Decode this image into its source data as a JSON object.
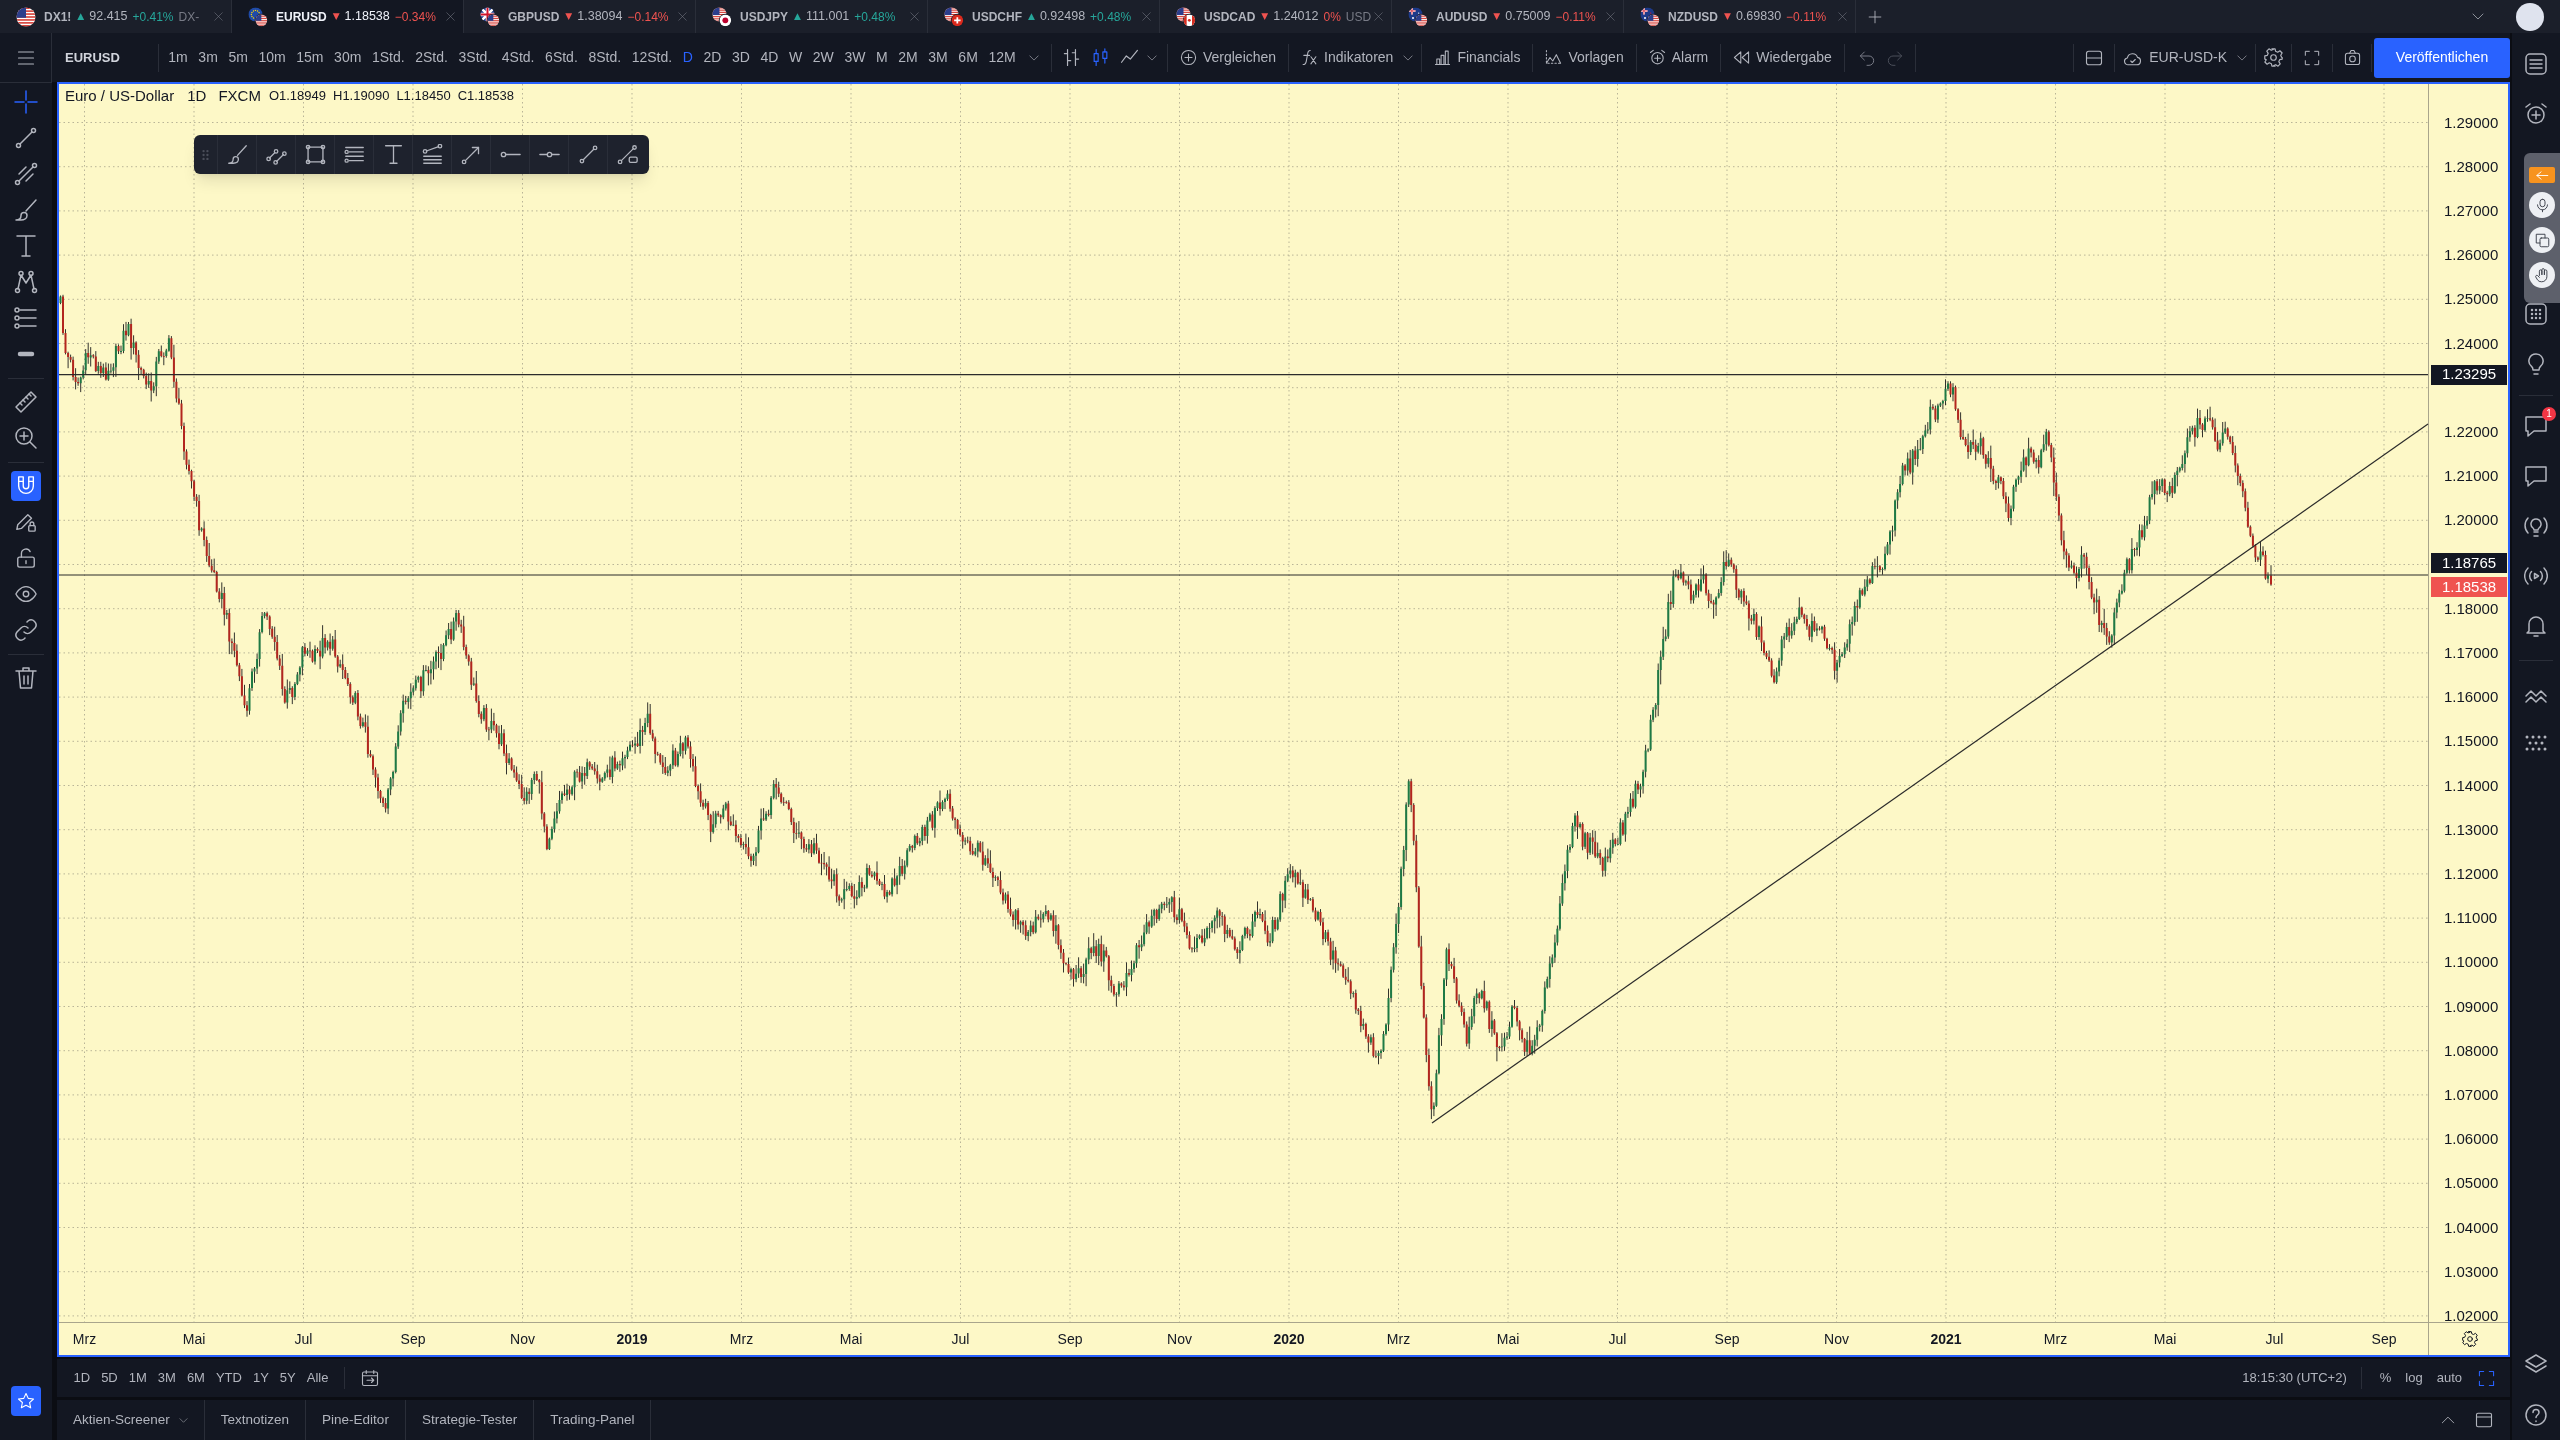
{
  "tabs": [
    {
      "symbol": "DX1!",
      "arrow": "▲",
      "price": "92.415",
      "change": "+0.41%",
      "description": "DX-",
      "rising": true,
      "selected": false
    },
    {
      "symbol": "EURUSD",
      "arrow": "▼",
      "price": "1.18538",
      "change": "−0.34%",
      "rising": false,
      "selected": true
    },
    {
      "symbol": "GBPUSD",
      "arrow": "▼",
      "price": "1.38094",
      "change": "−0.14%",
      "rising": false,
      "selected": false
    },
    {
      "symbol": "USDJPY",
      "arrow": "▲",
      "price": "111.001",
      "change": "+0.48%",
      "rising": true,
      "selected": false
    },
    {
      "symbol": "USDCHF",
      "arrow": "▲",
      "price": "0.92498",
      "change": "+0.48%",
      "rising": true,
      "selected": false
    },
    {
      "symbol": "USDCAD",
      "arrow": "▼",
      "price": "1.24012",
      "change": "0%",
      "description": "USD",
      "rising": false,
      "selected": false
    },
    {
      "symbol": "AUDUSD",
      "arrow": "▼",
      "price": "0.75009",
      "change": "−0.11%",
      "rising": false,
      "selected": false
    },
    {
      "symbol": "NZDUSD",
      "arrow": "▼",
      "price": "0.69830",
      "change": "−0.11%",
      "rising": false,
      "selected": false
    }
  ],
  "toolbar": {
    "symbol": "EURUSD",
    "intervals": [
      {
        "label": "1m",
        "selected": false
      },
      {
        "label": "3m",
        "selected": false
      },
      {
        "label": "5m",
        "selected": false
      },
      {
        "label": "10m",
        "selected": false
      },
      {
        "label": "15m",
        "selected": false
      },
      {
        "label": "30m",
        "selected": false
      },
      {
        "label": "1Std.",
        "selected": false
      },
      {
        "label": "2Std.",
        "selected": false
      },
      {
        "label": "3Std.",
        "selected": false
      },
      {
        "label": "4Std.",
        "selected": false
      },
      {
        "label": "6Std.",
        "selected": false
      },
      {
        "label": "8Std.",
        "selected": false
      },
      {
        "label": "12Std.",
        "selected": false
      },
      {
        "label": "D",
        "selected": true
      },
      {
        "label": "2D",
        "selected": false
      },
      {
        "label": "3D",
        "selected": false
      },
      {
        "label": "4D",
        "selected": false
      },
      {
        "label": "W",
        "selected": false
      },
      {
        "label": "2W",
        "selected": false
      },
      {
        "label": "3W",
        "selected": false
      },
      {
        "label": "M",
        "selected": false
      },
      {
        "label": "2M",
        "selected": false
      },
      {
        "label": "3M",
        "selected": false
      },
      {
        "label": "6M",
        "selected": false
      },
      {
        "label": "12M",
        "selected": false
      }
    ],
    "chart_types": [
      {
        "kind": "bars",
        "selected": false
      },
      {
        "kind": "candles",
        "selected": true
      },
      {
        "kind": "line",
        "selected": false
      }
    ],
    "actions": [
      {
        "kind": "compare",
        "label": "Vergleichen",
        "dropdown": false
      },
      {
        "kind": "indicators",
        "label": "Indikatoren",
        "dropdown": true
      },
      {
        "kind": "financials",
        "label": "Financials",
        "dropdown": false
      },
      {
        "kind": "templates",
        "label": "Vorlagen",
        "dropdown": false
      },
      {
        "kind": "alert",
        "label": "Alarm",
        "dropdown": false
      },
      {
        "kind": "replay",
        "label": "Wiedergabe",
        "dropdown": false
      }
    ],
    "layout_name": "EUR-USD-K",
    "publish_button": "Veröffentlichen"
  },
  "left_toolbar": {
    "groups": [
      {
        "tools": [
          {
            "kind": "crosshair",
            "selected": true
          },
          {
            "kind": "trend-line",
            "selected": false
          },
          {
            "kind": "fib",
            "selected": false
          },
          {
            "kind": "brush",
            "selected": false
          },
          {
            "kind": "text",
            "selected": false
          },
          {
            "kind": "pattern",
            "selected": false
          },
          {
            "kind": "prediction",
            "selected": false
          },
          {
            "kind": "bar",
            "selected": false
          }
        ]
      },
      {
        "tools": [
          {
            "kind": "ruler",
            "selected": false
          },
          {
            "kind": "zoom",
            "selected": false
          }
        ]
      },
      {
        "tools": [
          {
            "kind": "magnet",
            "on": true
          },
          {
            "kind": "pencil-lock",
            "on": false
          },
          {
            "kind": "lock",
            "on": false
          },
          {
            "kind": "eye",
            "on": false
          },
          {
            "kind": "link",
            "selected": false
          }
        ]
      },
      {
        "tools": [
          {
            "kind": "trash",
            "selected": false
          }
        ]
      }
    ]
  },
  "chart": {
    "title": "Euro / US-Dollar",
    "interval": "1D",
    "source": "FXCM",
    "ohlc": [
      "O1.18949",
      "H1.19090",
      "L1.18450",
      "C1.18538"
    ],
    "price_ticks": [
      "1.29000",
      "1.28000",
      "1.27000",
      "1.26000",
      "1.25000",
      "1.24000",
      "1.22000",
      "1.21000",
      "1.20000",
      "1.18000",
      "1.17000",
      "1.16000",
      "1.15000",
      "1.14000",
      "1.13000",
      "1.12000",
      "1.11000",
      "1.10000",
      "1.09000",
      "1.08000",
      "1.07000",
      "1.06000",
      "1.05000",
      "1.04000",
      "1.03000",
      "1.02000"
    ],
    "price_labels": [
      {
        "text": "1.23295",
        "kind": "line"
      },
      {
        "text": "1.18765",
        "kind": "line"
      },
      {
        "text": "1.18538",
        "kind": "last"
      }
    ],
    "time_ticks": [
      {
        "label": "Mrz",
        "kind": "month"
      },
      {
        "label": "Mai",
        "kind": "month"
      },
      {
        "label": "Jul",
        "kind": "month"
      },
      {
        "label": "Sep",
        "kind": "month"
      },
      {
        "label": "Nov",
        "kind": "month"
      },
      {
        "label": "2019",
        "kind": "year"
      },
      {
        "label": "Mrz",
        "kind": "month"
      },
      {
        "label": "Mai",
        "kind": "month"
      },
      {
        "label": "Jul",
        "kind": "month"
      },
      {
        "label": "Sep",
        "kind": "month"
      },
      {
        "label": "Nov",
        "kind": "month"
      },
      {
        "label": "2020",
        "kind": "year"
      },
      {
        "label": "Mrz",
        "kind": "month"
      },
      {
        "label": "Mai",
        "kind": "month"
      },
      {
        "label": "Jul",
        "kind": "month"
      },
      {
        "label": "Sep",
        "kind": "month"
      },
      {
        "label": "Nov",
        "kind": "month"
      },
      {
        "label": "2021",
        "kind": "year"
      },
      {
        "label": "Mrz",
        "kind": "month"
      },
      {
        "label": "Mai",
        "kind": "month"
      },
      {
        "label": "Jul",
        "kind": "month"
      },
      {
        "label": "Sep",
        "kind": "month"
      }
    ]
  },
  "bottom_toolbar": {
    "ranges": [
      "1D",
      "5D",
      "1M",
      "3M",
      "6M",
      "YTD",
      "1Y",
      "5Y",
      "Alle"
    ],
    "clock": "18:15:30 (UTC+2)",
    "scale_options": [
      "%",
      "log",
      "auto"
    ]
  },
  "panel_tabs": [
    {
      "label": "Aktien-Screener",
      "dropdown": true
    },
    {
      "label": "Textnotizen",
      "dropdown": false
    },
    {
      "label": "Pine-Editor",
      "dropdown": false
    },
    {
      "label": "Strategie-Tester",
      "dropdown": false
    },
    {
      "label": "Trading-Panel",
      "dropdown": false
    }
  ],
  "right_sidebar": {
    "badge": "1"
  }
}
